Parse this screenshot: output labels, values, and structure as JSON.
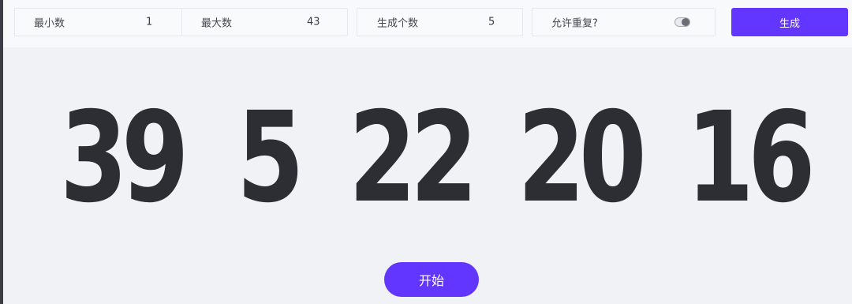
{
  "toolbar": {
    "min": {
      "label": "最小数",
      "value": "1"
    },
    "max": {
      "label": "最大数",
      "value": "43"
    },
    "count": {
      "label": "生成个数",
      "value": "5"
    },
    "repeat": {
      "label": "允许重复?",
      "enabled": true
    },
    "generate_label": "生成"
  },
  "results": [
    "39",
    "5",
    "22",
    "20",
    "16"
  ],
  "start_label": "开始",
  "colors": {
    "accent": "#6236ff",
    "number": "#2d2e34",
    "background": "#f1f2f6"
  }
}
